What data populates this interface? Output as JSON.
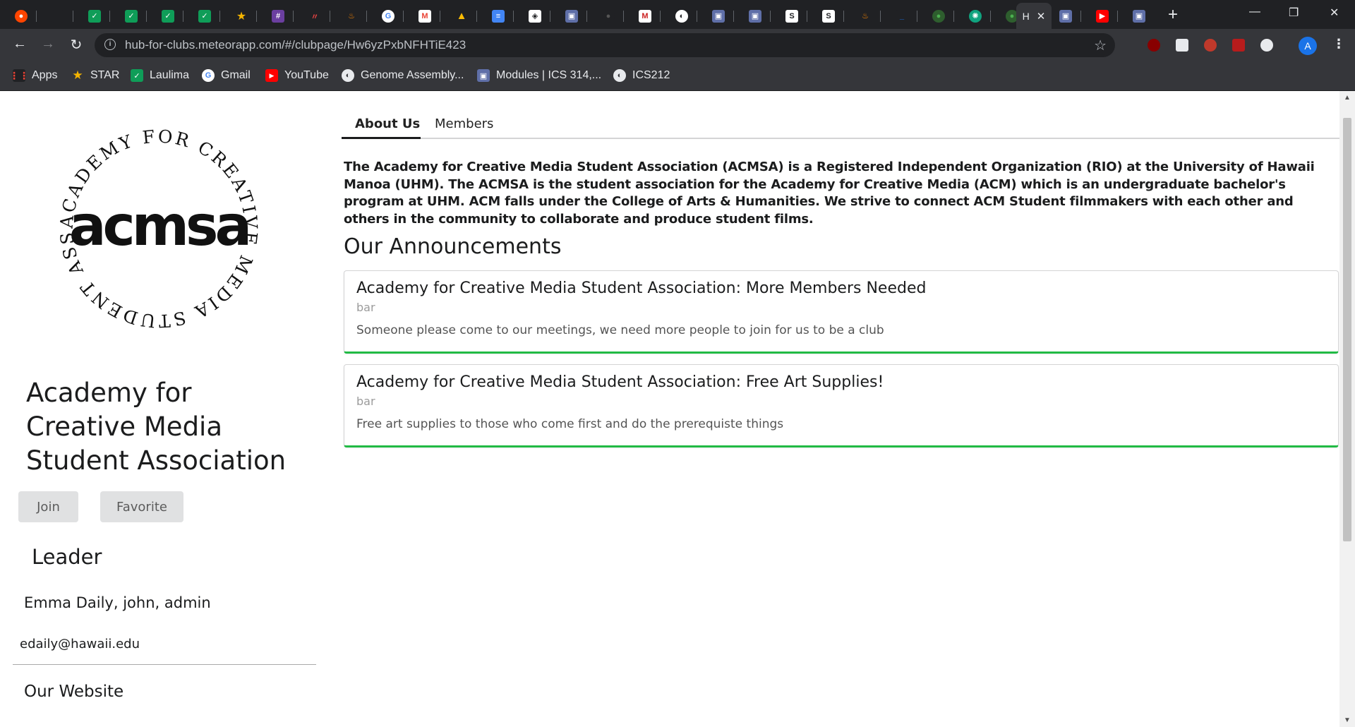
{
  "browser": {
    "url": "hub-for-clubs.meteorapp.com/#/clubpage/Hw6yzPxbNFHTiE423",
    "profile_initial": "A",
    "active_tab_label": "H"
  },
  "bookmarks": [
    {
      "label": "Apps",
      "icon": "apps-grid-icon",
      "color": "#ea4335"
    },
    {
      "label": "STAR",
      "icon": "star-logo-icon",
      "color": "#f4b400"
    },
    {
      "label": "Laulima",
      "icon": "laulima-icon",
      "color": "#0f9d58"
    },
    {
      "label": "Gmail",
      "icon": "google-icon",
      "color": "#ffffff"
    },
    {
      "label": "YouTube",
      "icon": "youtube-icon",
      "color": "#ff0000"
    },
    {
      "label": "Genome Assembly...",
      "icon": "globe-icon",
      "color": "#bdc1c6"
    },
    {
      "label": "Modules | ICS 314,...",
      "icon": "page-icon",
      "color": "#5f6fa8"
    },
    {
      "label": "ICS212",
      "icon": "globe-icon",
      "color": "#bdc1c6"
    }
  ],
  "logo": {
    "wordmark": "acmsa",
    "ring_text": "ACADEMY FOR CREATIVE MEDIA STUDENT ASSOCIATION"
  },
  "club": {
    "title": "Academy for Creative Media Student Association",
    "join_label": "Join",
    "favorite_label": "Favorite",
    "leader_heading": "Leader",
    "leader_names": "Emma Daily, john, admin",
    "leader_email": "edaily@hawaii.edu",
    "website_heading": "Our Website"
  },
  "tabs": {
    "about": "About Us",
    "members": "Members"
  },
  "about_text": "The Academy for Creative Media Student Association (ACMSA) is a Registered Independent Organization (RIO) at the University of Hawaii Manoa (UHM). The ACMSA is the student association for the Academy for Creative Media (ACM) which is an undergraduate bachelor's program at UHM. ACM falls under the College of Arts & Humanities. We strive to connect ACM Student filmmakers with each other and others in the community to collaborate and produce student films.",
  "announcements_heading": "Our Announcements",
  "announcements": [
    {
      "title": "Academy for Creative Media Student Association: More Members Needed",
      "meta": "bar",
      "description": "Someone please come to our meetings, we need more people to join for us to be a club"
    },
    {
      "title": "Academy for Creative Media Student Association: Free Art Supplies!",
      "meta": "bar",
      "description": "Free art supplies to those who come first and do the prerequiste things"
    }
  ],
  "colors": {
    "chrome_dark": "#202124",
    "chrome_toolbar": "#35363a",
    "card_accent": "#21ba45",
    "button_bg": "#e0e1e2"
  }
}
